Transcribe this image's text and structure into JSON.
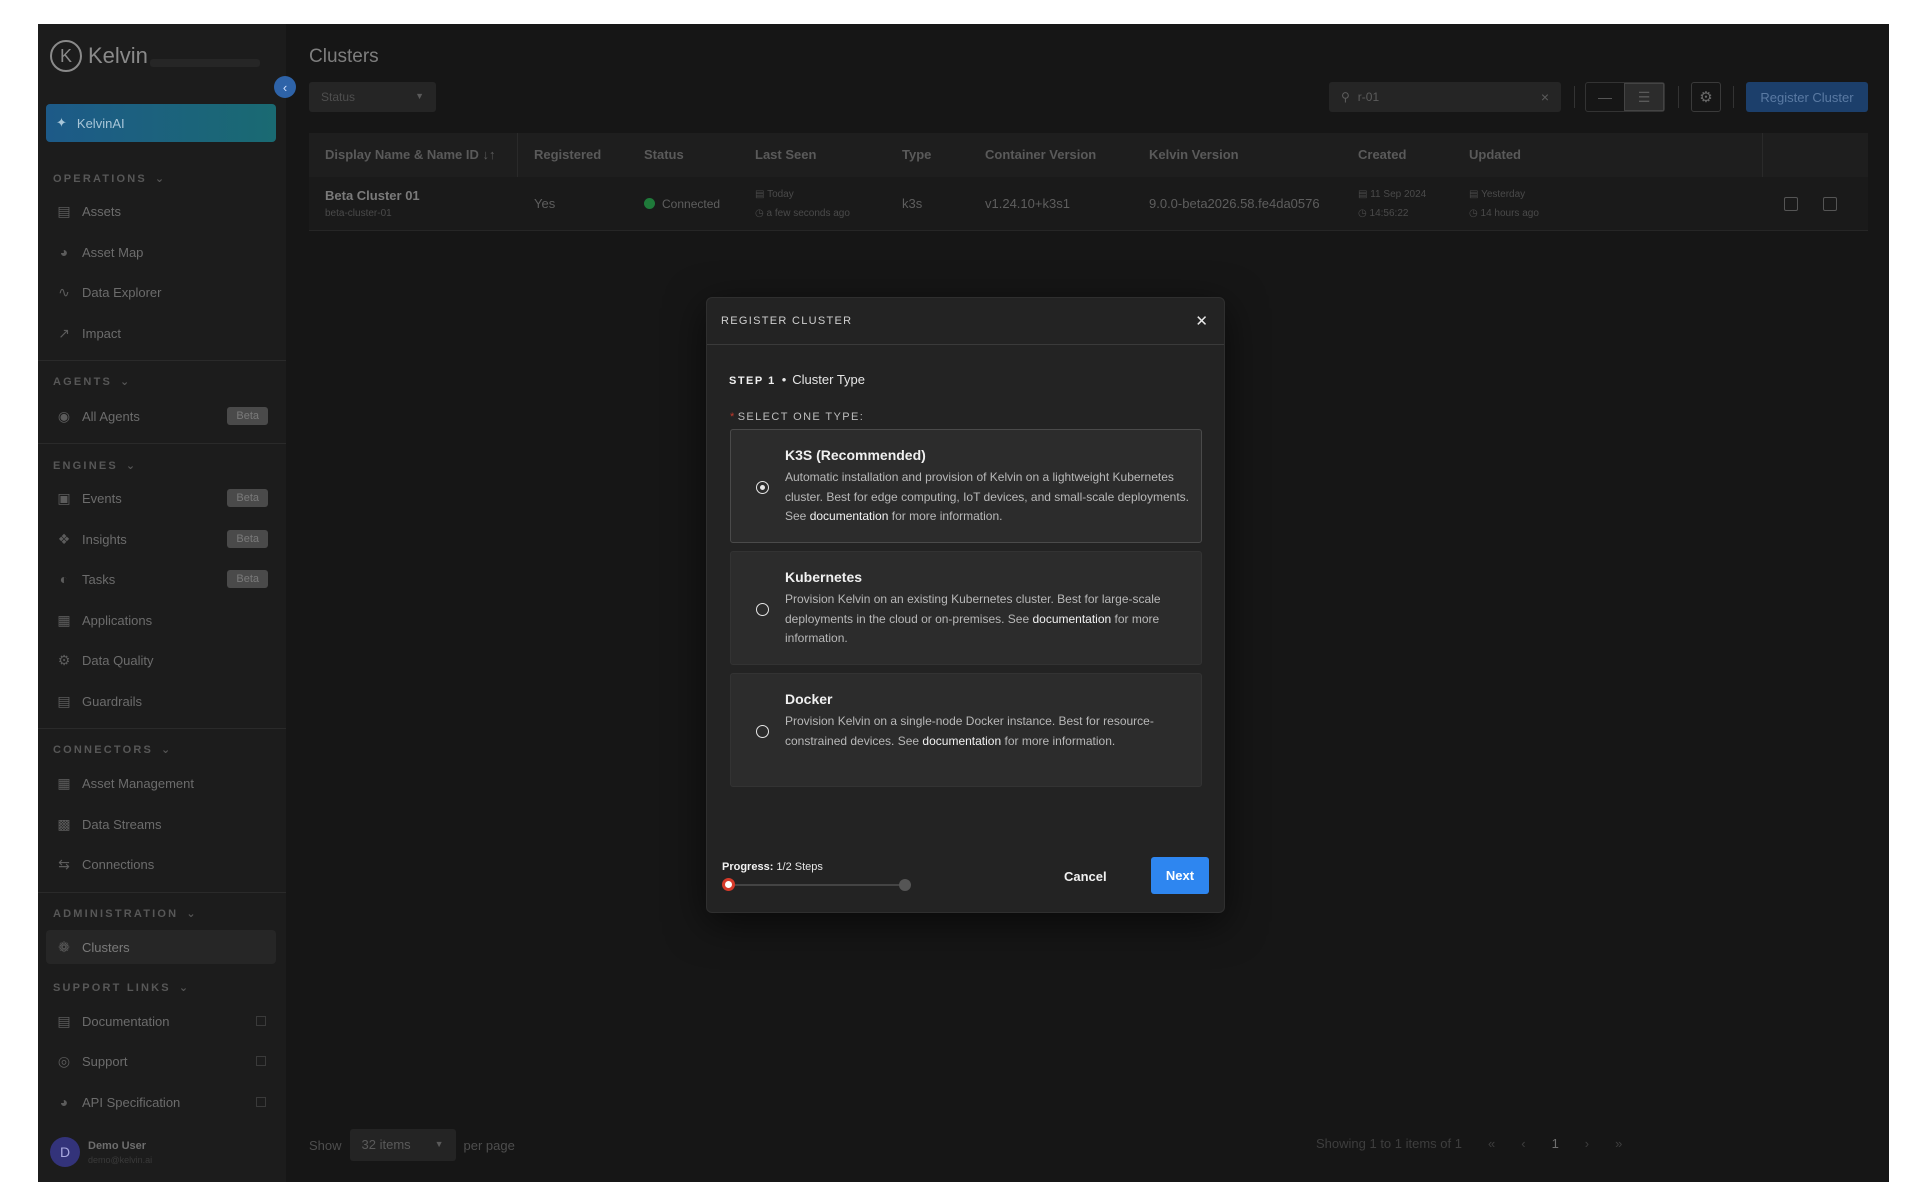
{
  "app": {
    "brand": "Kelvin"
  },
  "sidebar": {
    "kelvinai_label": "KelvinAI",
    "sections": {
      "operations": "OPERATIONS",
      "agents": "AGENTS",
      "engines": "ENGINES",
      "connectors": "CONNECTORS",
      "administration": "ADMINISTRATION",
      "support": "SUPPORT LINKS"
    },
    "items": {
      "assets": "Assets",
      "asset_map": "Asset Map",
      "data_explorer": "Data Explorer",
      "impact": "Impact",
      "all_agents": "All Agents",
      "events": "Events",
      "insights": "Insights",
      "tasks": "Tasks",
      "applications": "Applications",
      "data_quality": "Data Quality",
      "guardrails": "Guardrails",
      "asset_management": "Asset Management",
      "data_streams": "Data Streams",
      "connections": "Connections",
      "clusters": "Clusters",
      "documentation": "Documentation",
      "support": "Support",
      "api_spec": "API Specification"
    },
    "beta_badge": "Beta",
    "user": {
      "initial": "D",
      "name": "Demo User",
      "email": "demo@kelvin.ai"
    }
  },
  "main": {
    "title": "Clusters",
    "status_filter": "Status",
    "search_value": "r-01",
    "register_button": "Register Cluster",
    "table": {
      "headers": [
        "Display Name & Name ID",
        "Registered",
        "Status",
        "Last Seen",
        "Type",
        "Container Version",
        "Kelvin Version",
        "Created",
        "Updated"
      ],
      "row": {
        "display_name": "Beta Cluster 01",
        "name_id": "beta-cluster-01",
        "registered": "Yes",
        "status": "Connected",
        "last_seen_day": "Today",
        "last_seen_rel": "a few seconds ago",
        "type": "k3s",
        "container_version": "v1.24.10+k3s1",
        "kelvin_version": "9.0.0-beta2026.58.fe4da0576",
        "created_date": "11 Sep 2024",
        "created_time": "14:56:22",
        "updated_day": "Yesterday",
        "updated_rel": "14 hours ago"
      }
    },
    "pager": {
      "show": "Show",
      "items_per_page": "32 items",
      "per_page": "per page",
      "showing": "Showing 1 to 1 items of 1",
      "current_page": "1"
    }
  },
  "modal": {
    "title": "REGISTER CLUSTER",
    "step_label": "STEP 1",
    "step_name": "Cluster Type",
    "select_label": "SELECT ONE TYPE:",
    "options": [
      {
        "title": "K3S (Recommended)",
        "desc_before": "Automatic installation and provision of Kelvin on a lightweight Kubernetes cluster. Best for edge computing, IoT devices, and small-scale deployments. See ",
        "link": "documentation",
        "desc_after": " for more information.",
        "selected": true
      },
      {
        "title": "Kubernetes",
        "desc_before": "Provision Kelvin on an existing Kubernetes cluster. Best for large-scale deployments in the cloud or on-premises. See ",
        "link": "documentation",
        "desc_after": " for more information.",
        "selected": false
      },
      {
        "title": "Docker",
        "desc_before": "Provision Kelvin on a single-node Docker instance. Best for resource-constrained devices. See ",
        "link": "documentation",
        "desc_after": " for more information.",
        "selected": false
      }
    ],
    "progress_label": "Progress:",
    "progress_value": "1/2 Steps",
    "progress_fraction": 0.5,
    "cancel": "Cancel",
    "next": "Next"
  },
  "colors": {
    "primary": "#2e86f0",
    "danger": "#d63a2a",
    "success": "#1f7a3a"
  }
}
